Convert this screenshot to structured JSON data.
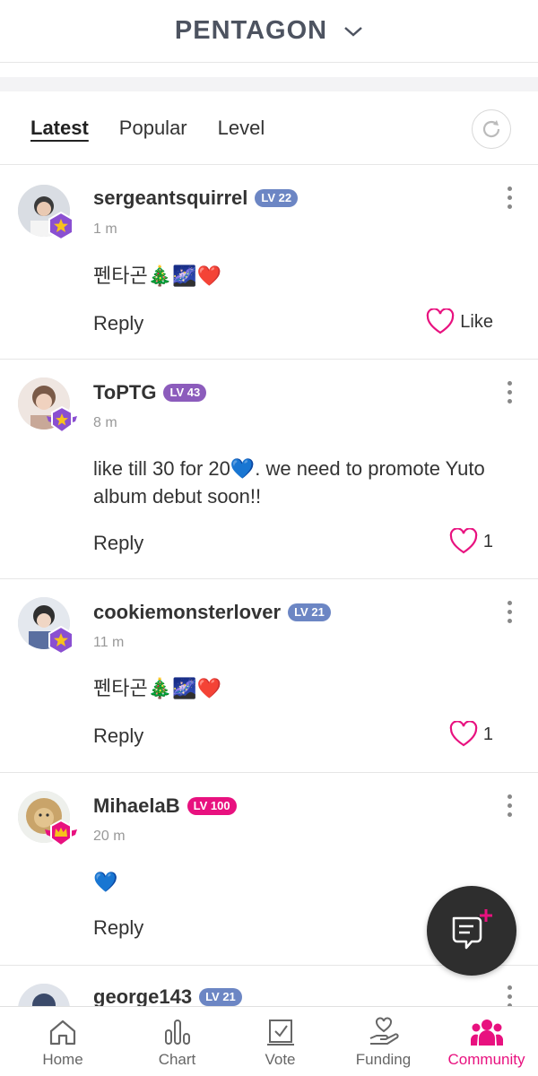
{
  "header": {
    "title": "PENTAGON"
  },
  "tabs": [
    {
      "label": "Latest",
      "active": true
    },
    {
      "label": "Popular",
      "active": false
    },
    {
      "label": "Level",
      "active": false
    }
  ],
  "comments": [
    {
      "username": "sergeantsquirrel",
      "level": "LV 22",
      "time": "1 m",
      "text": "펜타곤🎄🌌❤️",
      "reply": "Reply",
      "like": "Like"
    },
    {
      "username": "ToPTG",
      "level": "LV 43",
      "time": "8 m",
      "text": "like till 30 for 20💙. we need to promote Yuto album debut soon!!",
      "reply": "Reply",
      "like": "1"
    },
    {
      "username": "cookiemonsterlover",
      "level": "LV 21",
      "time": "11 m",
      "text": "펜타곤🎄🌌❤️",
      "reply": "Reply",
      "like": "1"
    },
    {
      "username": "MihaelaB",
      "level": "LV 100",
      "time": "20 m",
      "text": "💙",
      "reply": "Reply",
      "like": ""
    },
    {
      "username": "george143",
      "level": "LV 21"
    }
  ],
  "nav": [
    {
      "label": "Home",
      "icon": "home-icon"
    },
    {
      "label": "Chart",
      "icon": "chart-icon"
    },
    {
      "label": "Vote",
      "icon": "vote-icon"
    },
    {
      "label": "Funding",
      "icon": "funding-icon"
    },
    {
      "label": "Community",
      "icon": "community-icon",
      "active": true
    }
  ],
  "colors": {
    "accent": "#e8117f",
    "lvBlue": "#6c86c4",
    "lvPurple": "#8c5cbc",
    "fab": "#2e2e2e"
  }
}
